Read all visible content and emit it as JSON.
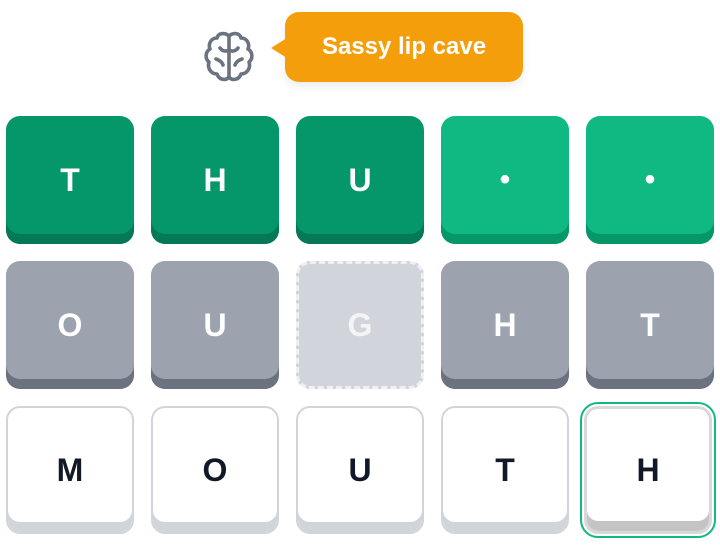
{
  "hint": {
    "icon": "brain-icon",
    "text": "Sassy lip cave",
    "color": "#f59e0b"
  },
  "rows": [
    [
      {
        "letter": "T",
        "state": "correct"
      },
      {
        "letter": "H",
        "state": "correct"
      },
      {
        "letter": "U",
        "state": "correct"
      },
      {
        "letter": "•",
        "state": "present"
      },
      {
        "letter": "•",
        "state": "present"
      }
    ],
    [
      {
        "letter": "O",
        "state": "absent"
      },
      {
        "letter": "U",
        "state": "absent"
      },
      {
        "letter": "G",
        "state": "ghost"
      },
      {
        "letter": "H",
        "state": "absent"
      },
      {
        "letter": "T",
        "state": "absent"
      }
    ],
    [
      {
        "letter": "M",
        "state": "empty"
      },
      {
        "letter": "O",
        "state": "empty"
      },
      {
        "letter": "U",
        "state": "empty"
      },
      {
        "letter": "T",
        "state": "empty"
      },
      {
        "letter": "H",
        "state": "active"
      }
    ]
  ],
  "colors": {
    "correct": "#059669",
    "present": "#10b981",
    "absent": "#9ca3af",
    "ghost": "#d1d5db"
  }
}
